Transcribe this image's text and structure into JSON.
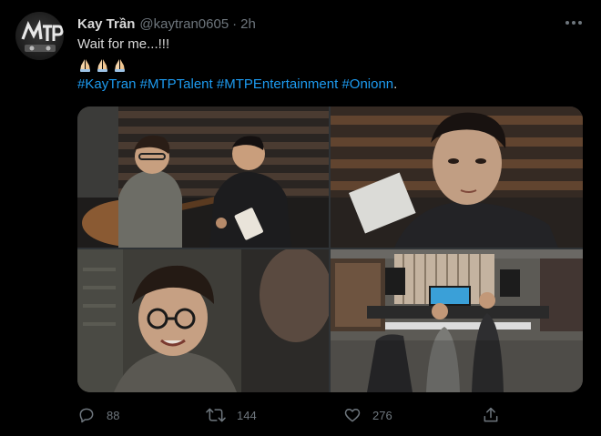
{
  "tweet": {
    "author_name": "Kay Trần",
    "handle": "@kaytran0605",
    "separator": "·",
    "time": "2h",
    "text": "Wait for me...!!!",
    "emojis": [
      "folded-hands",
      "folded-hands",
      "folded-hands"
    ],
    "hashtags": [
      "#KayTran",
      "#MTPTalent",
      "#MTPEntertainment",
      "#Onionn"
    ],
    "trailing_punctuation": ".",
    "avatar_logo_text": "MTP",
    "media": [
      {
        "name": "studio-guitar-photo"
      },
      {
        "name": "closeup-paper-photo"
      },
      {
        "name": "glasses-smile-photo"
      },
      {
        "name": "studio-desk-photo"
      }
    ],
    "actions": {
      "replies": "88",
      "retweets": "144",
      "likes": "276"
    }
  },
  "colors": {
    "background": "#000000",
    "text": "#d9d9d9",
    "secondary": "#6e767d",
    "link": "#1d9bf0"
  },
  "icons": [
    "more-icon",
    "reply-icon",
    "retweet-icon",
    "like-icon",
    "share-icon"
  ]
}
